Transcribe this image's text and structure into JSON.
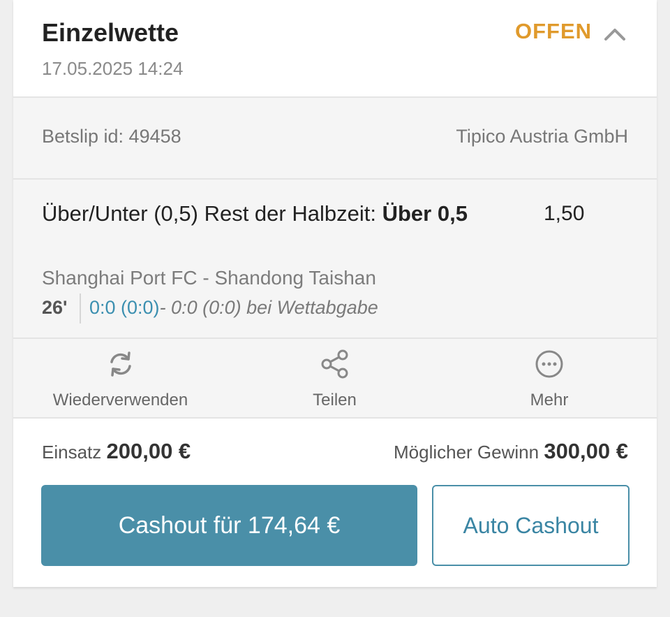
{
  "bet": {
    "type_title": "Einzelwette",
    "datetime": "17.05.2025 14:24",
    "status": "OFFEN",
    "status_color": "#e09a2c",
    "collapse_icon": "chevron-up-icon"
  },
  "meta": {
    "betslip_label": "Betslip id: 49458",
    "operator": "Tipico Austria GmbH"
  },
  "selection": {
    "market": "Über/Unter (0,5) Rest der Halbzeit:",
    "pick": "Über 0,5",
    "odds": "1,50",
    "event": "Shanghai Port FC - Shandong Taishan",
    "minute": "26'",
    "live_score": "0:0 (0:0)",
    "placed_score": "- 0:0 (0:0) bei Wettabgabe"
  },
  "actions": [
    {
      "label": "Wiederverwenden",
      "icon": "refresh-icon"
    },
    {
      "label": "Teilen",
      "icon": "share-icon"
    },
    {
      "label": "Mehr",
      "icon": "more-icon"
    }
  ],
  "stake": {
    "label": "Einsatz",
    "value": "200,00 €"
  },
  "potential_win": {
    "label": "Möglicher Gewinn",
    "value": "300,00 €"
  },
  "buttons": {
    "cashout": "Cashout für 174,64 €",
    "auto_cashout": "Auto Cashout"
  },
  "colors": {
    "accent": "#4a8fa8",
    "status": "#e09a2c",
    "live_score": "#3b8fb0"
  }
}
